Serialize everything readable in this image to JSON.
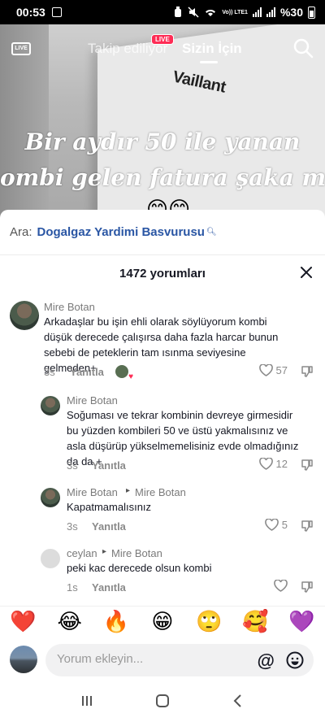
{
  "status_bar": {
    "time": "00:53",
    "network_label": "Vo)) LTE1",
    "battery": "%30"
  },
  "top_nav": {
    "live_icon_label": "LIVE",
    "following_tab": "Takip ediliyor",
    "live_badge": "LIVE",
    "for_you_tab": "Sizin İçin"
  },
  "video": {
    "brand_text": "Vaillant",
    "overlay_line1": "Bir aydır 50 ile yanan",
    "overlay_line2": "ombi gelen fatura şaka mı",
    "overlay_emojis": "😊😊"
  },
  "search": {
    "label": "Ara:",
    "query": "Dogalgaz Yardimi Basvurusu"
  },
  "comments_header": {
    "title": "1472 yorumları"
  },
  "comments": [
    {
      "user": "Mire  Botan",
      "text": "Arkadaşlar bu işin ehli olarak söylüyorum kombi düşük derecede çalışırsa daha fazla harcar bunun sebebi de peteklerin tam ısınma seviyesine gelmeden+",
      "time": "3s",
      "reply": "Yanıtla",
      "likes": "57"
    },
    {
      "user": "Mire  Botan",
      "text": "Soğuması ve tekrar kombinin devreye girmesidir bu yüzden kombileri 50 ve üstü yakmalısınız ve asla düşürüp yükselmemelisiniz evde olmadığınız da da +",
      "time": "3s",
      "reply": "Yanıtla",
      "likes": "12"
    },
    {
      "user": "Mire  Botan",
      "reply_to_arrow": "▸",
      "reply_to": "Mire  Botan",
      "text": "Kapatmamalısınız",
      "time": "3s",
      "reply": "Yanıtla",
      "likes": "5"
    },
    {
      "user": "ceylan",
      "reply_to_arrow": "▸",
      "reply_to": "Mire  Botan",
      "text": "peki kac derecede olsun kombi",
      "time": "1s",
      "reply": "Yanıtla",
      "likes": ""
    }
  ],
  "emoji_bar": [
    "❤️",
    "😂",
    "🔥",
    "😁",
    "🙄",
    "🥰",
    "💜"
  ],
  "comment_input": {
    "placeholder": "Yorum ekleyin...",
    "mention_symbol": "@"
  }
}
